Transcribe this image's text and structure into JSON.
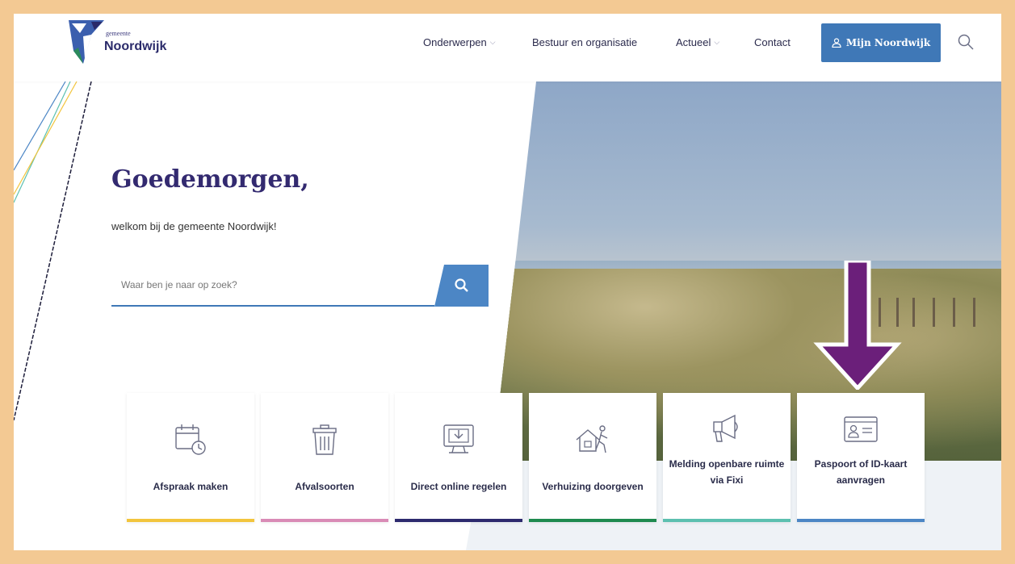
{
  "header": {
    "logo_small": "gemeente",
    "logo_big": "Noordwijk",
    "nav": [
      {
        "label": "Onderwerpen",
        "has_dropdown": true
      },
      {
        "label": "Bestuur en organisatie",
        "has_dropdown": false
      },
      {
        "label": "Actueel",
        "has_dropdown": true
      },
      {
        "label": "Contact",
        "has_dropdown": false
      }
    ],
    "mijn_button": "Mijn Noordwijk",
    "icons": {
      "user": "user-icon",
      "search": "search-icon",
      "chevron": "chevron-down-icon"
    }
  },
  "hero": {
    "greeting": "Goedemorgen,",
    "welcome": "welkom bij de gemeente Noordwijk!",
    "search_placeholder": "Waar ben je naar op zoek?"
  },
  "cards": [
    {
      "label": "Afspraak maken",
      "icon": "calendar-clock-icon",
      "bar_color": "#f2c53d"
    },
    {
      "label": "Afvalsoorten",
      "icon": "trash-bin-icon",
      "bar_color": "#d98bb6"
    },
    {
      "label": "Direct online regelen",
      "icon": "monitor-download-icon",
      "bar_color": "#2d2a6e"
    },
    {
      "label": "Verhuizing doorgeven",
      "icon": "moving-house-icon",
      "bar_color": "#1e8a4f"
    },
    {
      "label": "Melding openbare ruimte via Fixi",
      "icon": "megaphone-icon",
      "bar_color": "#5cc0b0"
    },
    {
      "label": "Paspoort of ID-kaart aanvragen",
      "icon": "id-card-icon",
      "bar_color": "#4c86c5"
    }
  ],
  "annotation": {
    "arrow_color": "#6b1f7a",
    "arrow_icon": "down-arrow-icon"
  }
}
